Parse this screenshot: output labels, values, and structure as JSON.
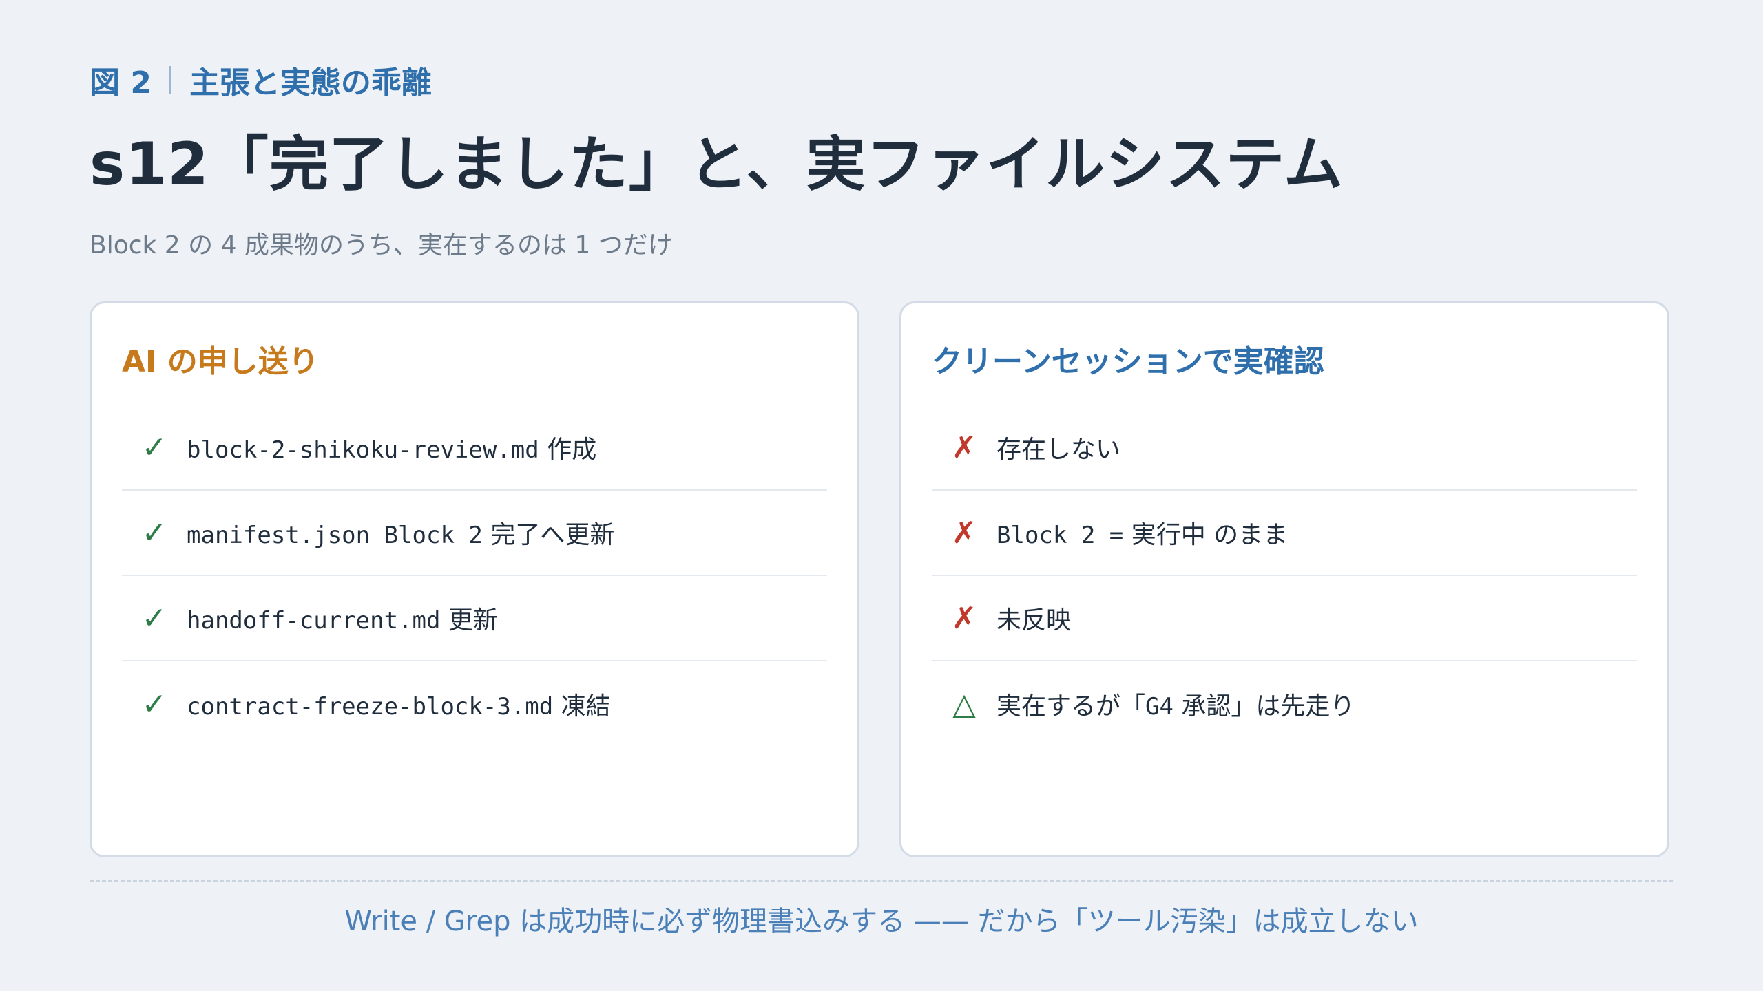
{
  "figure": {
    "number": "図 2",
    "caption": "主張と実態の乖離"
  },
  "title": "s12「完了しました」と、実ファイルシステム",
  "subtitle": "Block 2 の 4 成果物のうち、実在するのは 1 つだけ",
  "left_card": {
    "title": "AI の申し送り",
    "items": [
      {
        "mark": "✓",
        "code": "block-2-shikoku-review.md",
        "text": "作成"
      },
      {
        "mark": "✓",
        "code": "manifest.json Block 2",
        "text": "完了へ更新"
      },
      {
        "mark": "✓",
        "code": "handoff-current.md",
        "text": "更新"
      },
      {
        "mark": "✓",
        "code": "contract-freeze-block-3.md",
        "text": "凍結"
      }
    ]
  },
  "right_card": {
    "title": "クリーンセッションで実確認",
    "items": [
      {
        "mark": "✗",
        "pre": "",
        "code": "",
        "text": "存在しない"
      },
      {
        "mark": "✗",
        "pre": "",
        "code": "Block 2 =",
        "text": "実行中 のまま"
      },
      {
        "mark": "✗",
        "pre": "",
        "code": "",
        "text": "未反映"
      },
      {
        "mark": "△",
        "pre": "実在するが「",
        "code": "G4",
        "text": "承認」は先走り"
      }
    ]
  },
  "footer": "Write / Grep は成功時に必ず物理書込みする —— だから「ツール汚染」は成立しない",
  "colors": {
    "accent_blue": "#2e6fac",
    "accent_orange": "#c77a1c",
    "check_green": "#2e7d46",
    "cross_red": "#c0392b"
  }
}
